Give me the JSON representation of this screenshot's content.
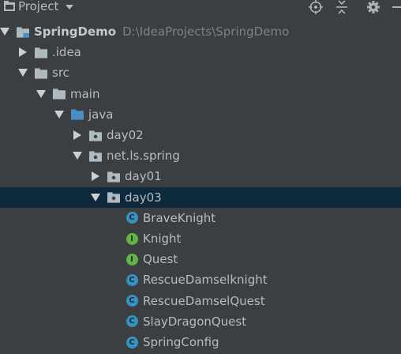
{
  "header": {
    "title": "Project",
    "icons": [
      "project-icon",
      "caret-down-icon",
      "target-icon",
      "collapse-icon",
      "gear-icon",
      "minimize-icon"
    ]
  },
  "colors": {
    "background": "#3c3f41",
    "selected_row": "#0d293e",
    "folder": "#aeb9c0",
    "source_folder": "#4a8fc4",
    "class_icon": "#3592c4",
    "interface_icon": "#62b543",
    "arrow": "#cfcfcf",
    "path_text": "#808080"
  },
  "tree": [
    {
      "label": "SpringDemo",
      "path": "D:\\IdeaProjects\\SpringDemo",
      "depth": 0,
      "expanded": true,
      "icon": "module-folder-icon",
      "bold": true
    },
    {
      "label": ".idea",
      "depth": 1,
      "expanded": false,
      "icon": "folder-icon"
    },
    {
      "label": "src",
      "depth": 1,
      "expanded": true,
      "icon": "folder-icon"
    },
    {
      "label": "main",
      "depth": 2,
      "expanded": true,
      "icon": "folder-icon"
    },
    {
      "label": "java",
      "depth": 3,
      "expanded": true,
      "icon": "source-folder-icon"
    },
    {
      "label": "day02",
      "depth": 4,
      "expanded": false,
      "icon": "package-icon"
    },
    {
      "label": "net.ls.spring",
      "depth": 4,
      "expanded": true,
      "icon": "package-icon"
    },
    {
      "label": "day01",
      "depth": 5,
      "expanded": false,
      "icon": "package-icon"
    },
    {
      "label": "day03",
      "depth": 5,
      "expanded": true,
      "icon": "package-icon",
      "selected": true
    },
    {
      "label": "BraveKnight",
      "depth": 6,
      "icon": "class-icon",
      "letter": "C"
    },
    {
      "label": "Knight",
      "depth": 6,
      "icon": "interface-icon",
      "letter": "I"
    },
    {
      "label": "Quest",
      "depth": 6,
      "icon": "interface-icon",
      "letter": "I"
    },
    {
      "label": "RescueDamselknight",
      "depth": 6,
      "icon": "class-icon",
      "letter": "C"
    },
    {
      "label": "RescueDamselQuest",
      "depth": 6,
      "icon": "class-icon",
      "letter": "C"
    },
    {
      "label": "SlayDragonQuest",
      "depth": 6,
      "icon": "class-icon",
      "letter": "C"
    },
    {
      "label": "SpringConfig",
      "depth": 6,
      "icon": "class-icon",
      "letter": "C"
    }
  ]
}
